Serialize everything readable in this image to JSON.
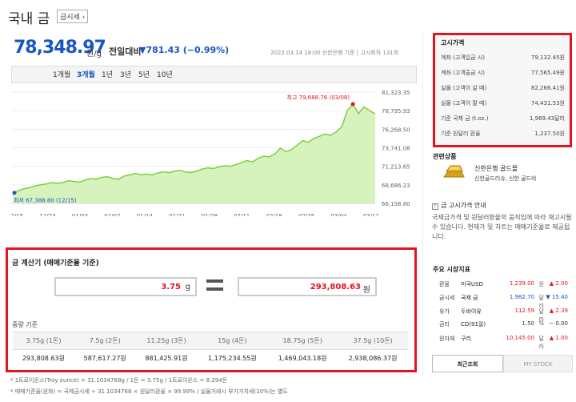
{
  "header": {
    "title": "국내 금",
    "badge": "금시세 ›"
  },
  "quote": {
    "price": "78,348.97",
    "unit": "원/g",
    "change_label": "전일대비",
    "change": "▼781.43 (−0.99%)",
    "meta": "2022.03.14 18:00  신한은행 기준  |  고시회차 131회"
  },
  "periods": [
    "1개월",
    "3개월",
    "1년",
    "3년",
    "5년",
    "10년"
  ],
  "active_period": "3개월",
  "chart_data": {
    "type": "area",
    "x_ticks": [
      "12/15",
      "12/23",
      "01/03",
      "01/07",
      "01/14",
      "01/21",
      "01/28",
      "02/11",
      "02/18",
      "02/25",
      "03/04",
      "03/11"
    ],
    "y_ticks": [
      "81,323.35",
      "78,795.93",
      "76,268.50",
      "73,741.08",
      "71,213.65",
      "68,686.23",
      "66,158.80"
    ],
    "ylim": [
      66158.8,
      81323.35
    ],
    "values": [
      67388.8,
      67900,
      68150,
      68300,
      68550,
      68700,
      68800,
      69000,
      68900,
      69000,
      69250,
      69150,
      69050,
      69350,
      69550,
      69450,
      69700,
      69800,
      69550,
      69450,
      69900,
      70050,
      70250,
      70050,
      70150,
      70050,
      70300,
      70450,
      70350,
      70550,
      70650,
      70450,
      70350,
      70550,
      70850,
      71000,
      70900,
      71150,
      71300,
      71200,
      71450,
      71700,
      72000,
      71800,
      72300,
      72600,
      72500,
      72900,
      73700,
      73200,
      73500,
      74100,
      74700,
      74500,
      75000,
      75300,
      75600,
      75450,
      75900,
      76600,
      78800,
      79688.76,
      78400,
      79300,
      78800,
      78348.97
    ],
    "high_label": "최고 79,688.76 (03/08)",
    "low_label": "최저 67,388.80 (12/15)",
    "colors": {
      "line": "#7ccf3e",
      "fill": "#d7f3bd",
      "high": "#e0151f",
      "low": "#1a55c5"
    }
  },
  "calculator": {
    "title": "금 계산기 (매매기준율 기준)",
    "input_value": "3.75",
    "input_unit": "g",
    "output_value": "293,808.63",
    "output_unit": "원",
    "weight_title": "중량 기준",
    "headers": [
      "3.75g (1돈)",
      "7.5g (2돈)",
      "11.25g (3돈)",
      "15g (4돈)",
      "18.75g (5돈)",
      "37.5g (10돈)"
    ],
    "values": [
      "293,808.63원",
      "587,617.27원",
      "881,425.91원",
      "1,175,234.55원",
      "1,469,043.18원",
      "2,938,086.37원"
    ]
  },
  "notes": [
    "* 1트로이온스(Troy ounce) = 31.1034768g / 1돈 = 3.75g / 1트로이온스 = 8.294돈",
    "* 매매기준율(원화) = 국제금시세 ÷ 31.1034768 × 원달러환율 × 99.99%  /  실물거래시 부가가치세(10%)는 별도"
  ],
  "notice": {
    "title": "고시가격",
    "rows": [
      {
        "label": "계좌 (고객입금 시)",
        "value": "79,132.45원"
      },
      {
        "label": "계좌 (고객출금 시)",
        "value": "77,565.49원"
      },
      {
        "label": "실물 (고객이 살 때)",
        "value": "82,266.41원"
      },
      {
        "label": "실물 (고객이 팔 때)",
        "value": "74,431.53원"
      },
      {
        "label": "기준 국제 금 (t.oz.)",
        "value": "1,969.43달러"
      },
      {
        "label": "기준 원달러 환율",
        "value": "1,237.50원"
      }
    ]
  },
  "related": {
    "title": "관련상품",
    "name": "신한은행 골드몰",
    "desc": "신한골드리슈, 신한 골드바"
  },
  "info": {
    "title": "금 고시가격 안내",
    "desc": "국제금가격 및 원달러환율의 움직임에 따라 재고시될 수 있습니다. 현재가 및 차트는 매매기준율로 제공됩니다."
  },
  "market": {
    "title": "주요 시장지표",
    "rows": [
      {
        "cat": "환율",
        "name": "미국USD",
        "value": "1,239.00",
        "unit": "원",
        "change": "▲ 2.00",
        "color": "#e0151f"
      },
      {
        "cat": "금시세",
        "name": "국제 금",
        "value": "1,982.70",
        "unit": "달러",
        "change": "▼ 15.40",
        "color": "#1a55c5"
      },
      {
        "cat": "유가",
        "name": "두바이유",
        "value": "112.59",
        "unit": "달러",
        "change": "▲ 2.39",
        "color": "#e0151f"
      },
      {
        "cat": "금리",
        "name": "CD(91일)",
        "value": "1.50",
        "unit": "%",
        "change": "− 0.00",
        "color": "#333333"
      },
      {
        "cat": "원자재",
        "name": "구리",
        "value": "10,145.00",
        "unit": "달러",
        "change": "▲ 1.00",
        "color": "#e0151f"
      }
    ]
  },
  "tabs": {
    "recent": "최근조회",
    "mystock": "MY STOCK"
  }
}
